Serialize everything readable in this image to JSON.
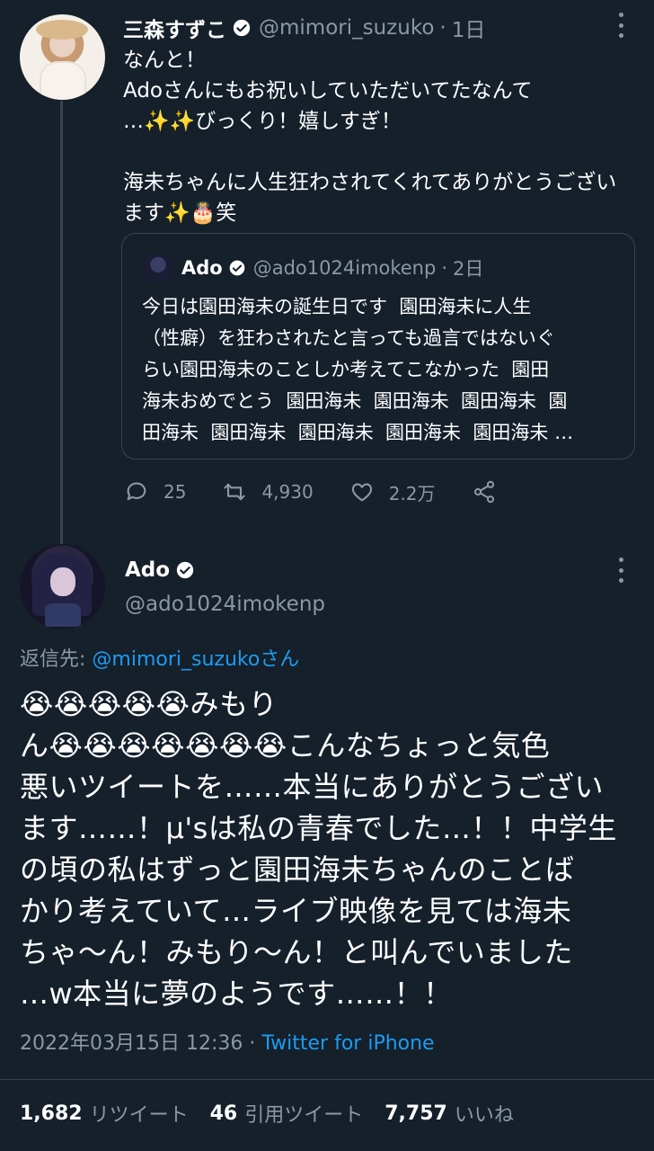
{
  "tweet1": {
    "name": "三森すずこ",
    "handle": "@mimori_suzuko",
    "time": "1日",
    "text": "なんと！\nAdoさんにもお祝いしていただいてたなんて\n…✨✨びっくり！嬉しすぎ！\n\n海未ちゃんに人生狂わされてくれてありがとうござい\nます✨🎂笑",
    "quote": {
      "name": "Ado",
      "handle": "@ado1024imokenp",
      "time": "2日",
      "text": "今日は園田海未の誕生日です  園田海未に人生\n（性癖）を狂わされたと言っても過言ではないぐ\nらい園田海未のことしか考えてこなかった  園田\n海未おめでとう  園田海未  園田海未  園田海未  園\n田海未  園田海未  園田海未  園田海未  園田海未 …"
    },
    "actions": {
      "replies": "25",
      "retweets": "4,930",
      "likes": "2.2万"
    }
  },
  "tweet2": {
    "name": "Ado",
    "handle": "@ado1024imokenp",
    "reply_prefix": "返信先: ",
    "reply_to": "@mimori_suzukoさん",
    "text": "😭😭😭😭😭みもり\nん😭😭😭😭😭😭😭こんなちょっと気色\n悪いツイートを……本当にありがとうござい\nます……！μ'sは私の青春でした…！！中学生\nの頃の私はずっと園田海未ちゃんのことば\nかり考えていて…ライブ映像を見ては海未\nちゃ〜ん！みもり〜ん！と叫んでいました\n…w本当に夢のようです……！！",
    "timestamp": "2022年03月15日 12:36",
    "separator": " · ",
    "source": "Twitter for iPhone",
    "stats": {
      "retweets": "1,682",
      "retweets_label": "リツイート",
      "quotes": "46",
      "quotes_label": "引用ツイート",
      "likes": "7,757",
      "likes_label": "いいね"
    }
  },
  "colors": {
    "background": "#15202b",
    "text": "#ffffff",
    "secondary": "#8b98a5",
    "link": "#1d9bf0",
    "border": "#38444d"
  },
  "icons": [
    "verified-icon",
    "more-icon",
    "reply-icon",
    "retweet-icon",
    "like-icon",
    "share-icon"
  ]
}
